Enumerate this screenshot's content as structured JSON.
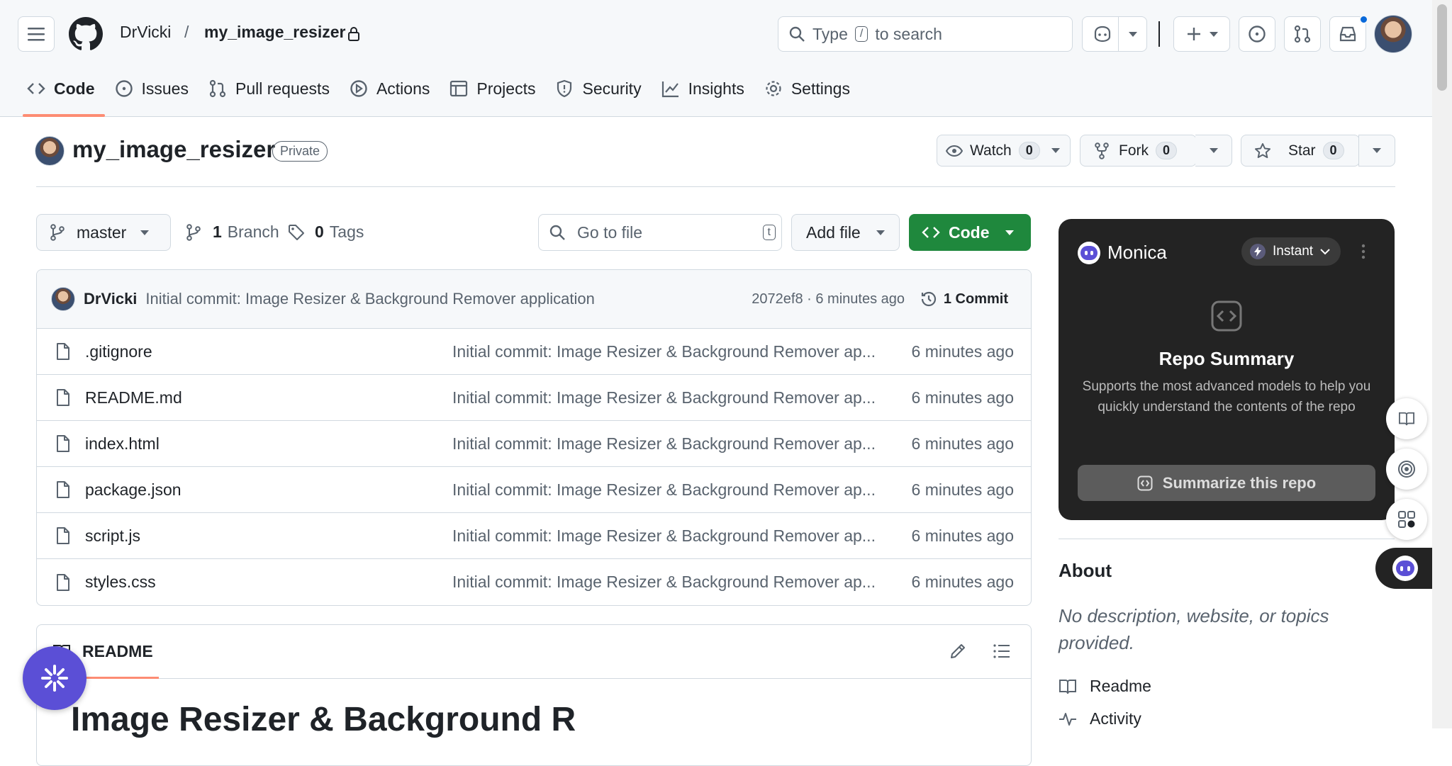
{
  "header": {
    "owner": "DrVicki",
    "separator": "/",
    "repo": "my_image_resizer",
    "search_prefix": "Type",
    "search_key": "/",
    "search_suffix": "to search",
    "icons": [
      "menu-icon",
      "github-logo-icon",
      "lock-icon",
      "copilot-icon",
      "plus-icon",
      "issue-icon",
      "pull-request-icon",
      "inbox-icon"
    ],
    "notification_color": "#0969da"
  },
  "tabs": [
    {
      "label": "Code",
      "icon": "code-icon",
      "selected": true
    },
    {
      "label": "Issues",
      "icon": "issue-icon"
    },
    {
      "label": "Pull requests",
      "icon": "pull-request-icon"
    },
    {
      "label": "Actions",
      "icon": "play-icon"
    },
    {
      "label": "Projects",
      "icon": "table-icon"
    },
    {
      "label": "Security",
      "icon": "shield-icon"
    },
    {
      "label": "Insights",
      "icon": "graph-icon"
    },
    {
      "label": "Settings",
      "icon": "gear-icon"
    }
  ],
  "repo_header": {
    "name": "my_image_resizer",
    "visibility": "Private",
    "watch_label": "Watch",
    "watch_count": "0",
    "fork_label": "Fork",
    "fork_count": "0",
    "star_label": "Star",
    "star_count": "0"
  },
  "toolbar": {
    "branch": "master",
    "branch_count": "1",
    "branch_label": "Branch",
    "tag_count": "0",
    "tag_label": "Tags",
    "goto_placeholder": "Go to file",
    "goto_key": "t",
    "add_file_label": "Add file",
    "code_label": "Code",
    "code_color": "#1f883d"
  },
  "latest_commit": {
    "author": "DrVicki",
    "message": "Initial commit: Image Resizer & Background Remover application",
    "sha_time": "2072ef8 · 6 minutes ago",
    "commits_label": "1 Commit"
  },
  "files": [
    {
      "name": ".gitignore",
      "message": "Initial commit: Image Resizer & Background Remover ap...",
      "age": "6 minutes ago"
    },
    {
      "name": "README.md",
      "message": "Initial commit: Image Resizer & Background Remover ap...",
      "age": "6 minutes ago"
    },
    {
      "name": "index.html",
      "message": "Initial commit: Image Resizer & Background Remover ap...",
      "age": "6 minutes ago"
    },
    {
      "name": "package.json",
      "message": "Initial commit: Image Resizer & Background Remover ap...",
      "age": "6 minutes ago"
    },
    {
      "name": "script.js",
      "message": "Initial commit: Image Resizer & Background Remover ap...",
      "age": "6 minutes ago"
    },
    {
      "name": "styles.css",
      "message": "Initial commit: Image Resizer & Background Remover ap...",
      "age": "6 minutes ago"
    }
  ],
  "readme": {
    "tab_label": "README",
    "heading": "Image Resizer & Background R"
  },
  "monica": {
    "brand": "Monica",
    "mode": "Instant",
    "title": "Repo Summary",
    "description": "Supports the most advanced models to help you quickly understand the contents of the repo",
    "button_label": "Summarize this repo",
    "bg_color": "#232323"
  },
  "about": {
    "heading": "About",
    "description": "No description, website, or topics provided.",
    "links": [
      {
        "label": "Readme",
        "icon": "book-icon"
      },
      {
        "label": "Activity",
        "icon": "pulse-icon"
      }
    ]
  }
}
